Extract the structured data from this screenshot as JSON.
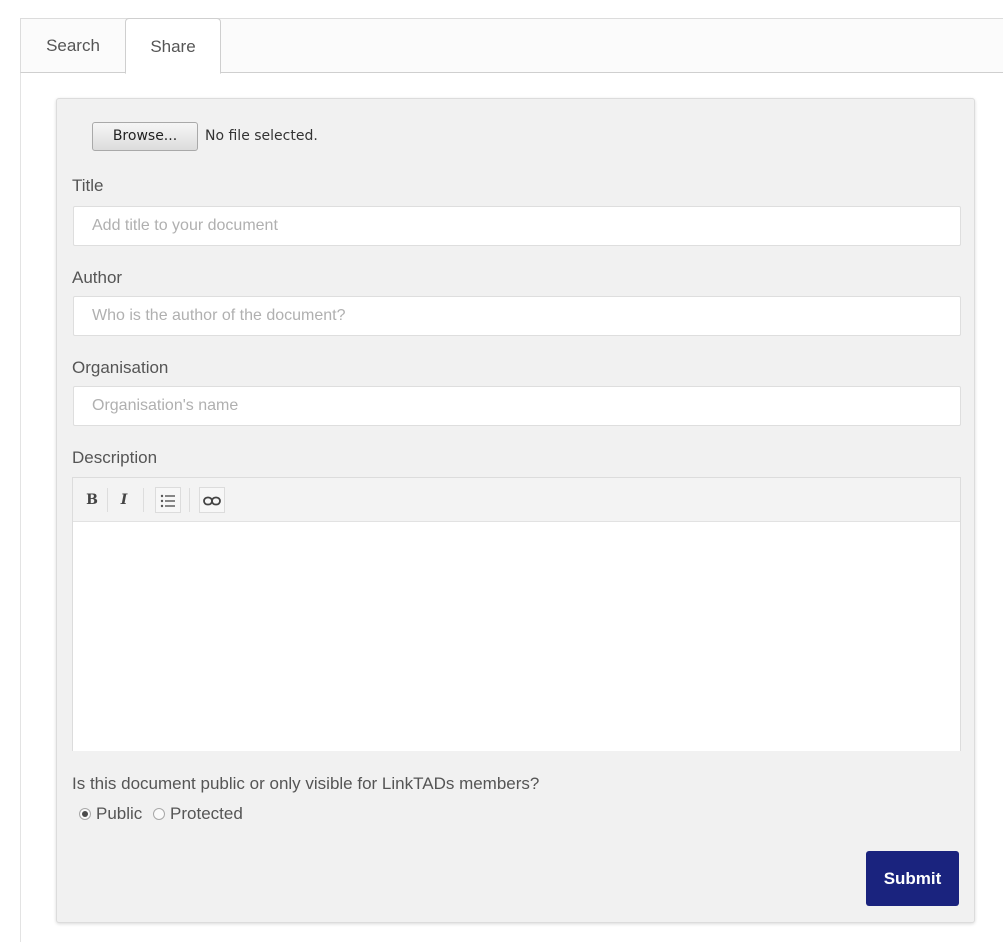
{
  "tabs": [
    {
      "label": "Search",
      "active": false
    },
    {
      "label": "Share",
      "active": true
    }
  ],
  "file": {
    "browse_label": "Browse...",
    "status": "No file selected."
  },
  "form": {
    "title": {
      "label": "Title",
      "placeholder": "Add title to your document",
      "value": ""
    },
    "author": {
      "label": "Author",
      "placeholder": "Who is the author of the document?",
      "value": ""
    },
    "organisation": {
      "label": "Organisation",
      "placeholder": "Organisation's name",
      "value": ""
    },
    "description": {
      "label": "Description",
      "toolbar": {
        "bold": "B",
        "italic": "I",
        "list_icon": "list-icon",
        "link_icon": "link-icon"
      },
      "value": ""
    },
    "visibility": {
      "question": "Is this document public or only visible for LinkTADs members?",
      "options": [
        {
          "label": "Public",
          "checked": true
        },
        {
          "label": "Protected",
          "checked": false
        }
      ]
    },
    "submit_label": "Submit"
  },
  "colors": {
    "submit_bg": "#1a237e",
    "panel_bg": "#f1f1f1"
  }
}
